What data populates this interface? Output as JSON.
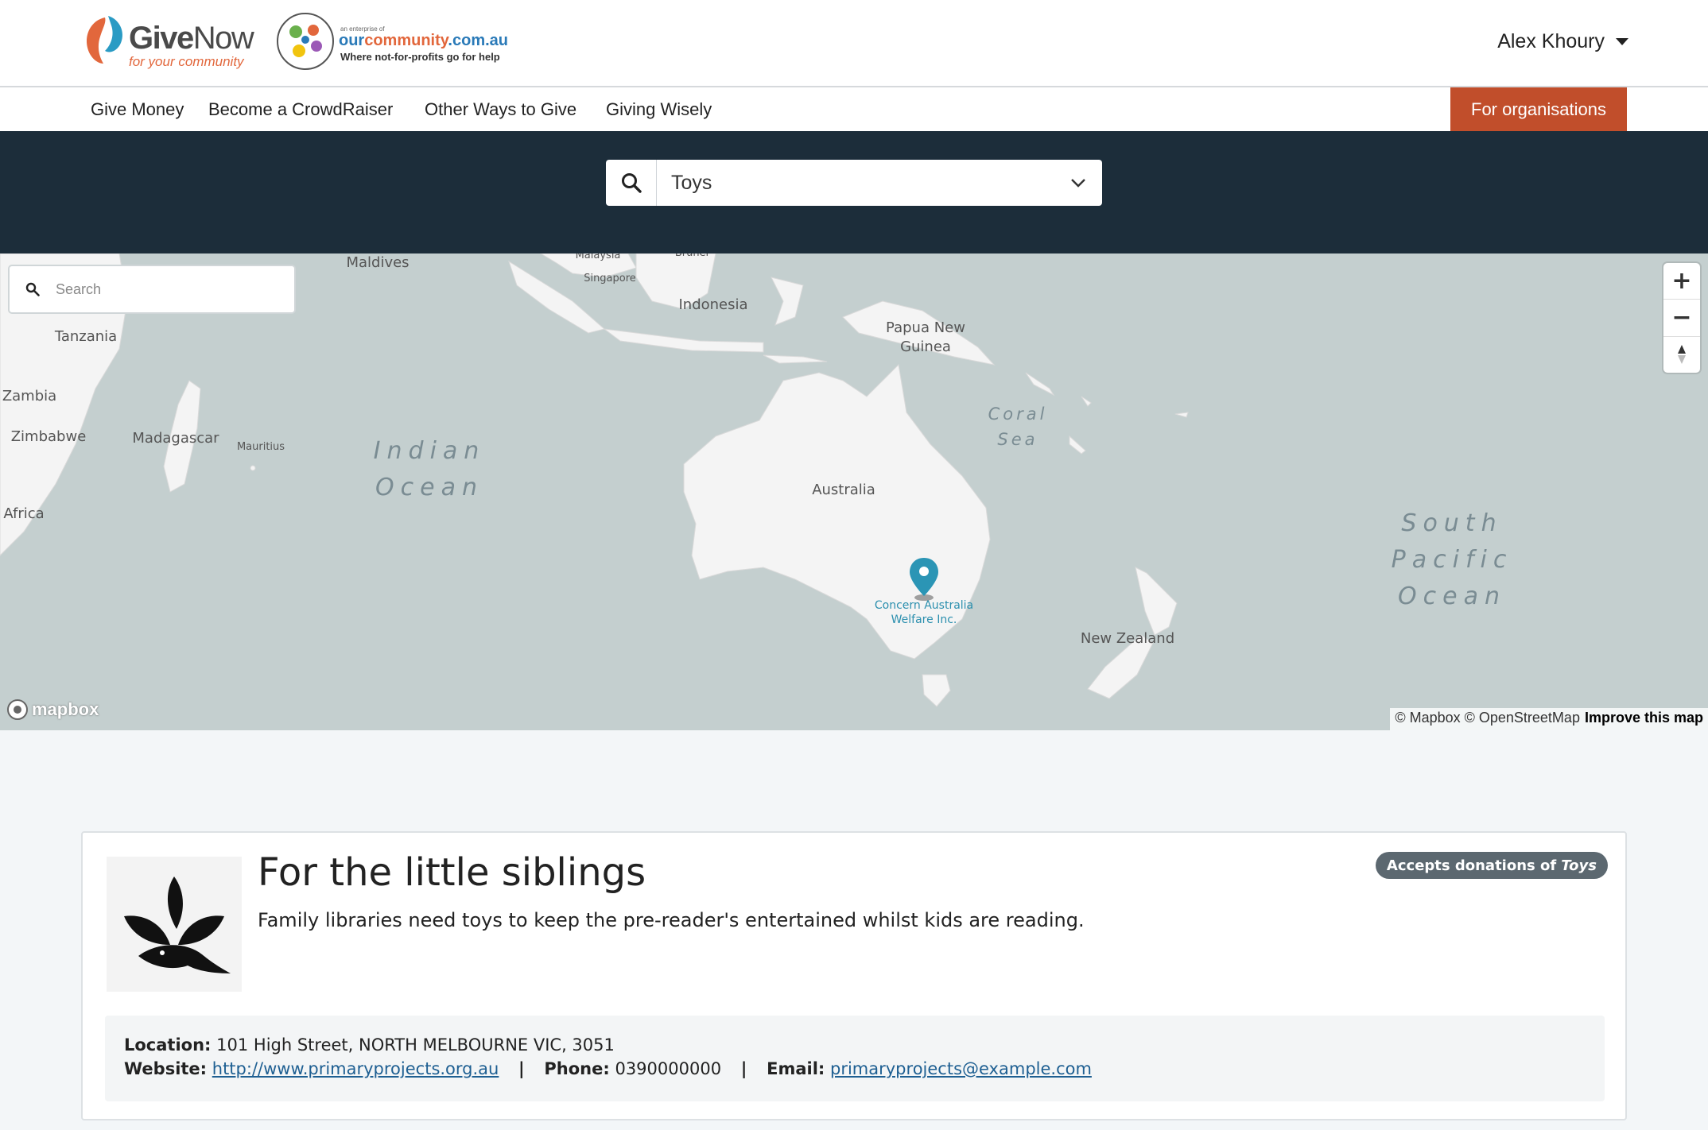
{
  "header": {
    "givenow_logo": {
      "give": "Give",
      "now": "Now",
      "tagline": "for your community"
    },
    "ourcommunity_logo": {
      "enterprise": "an enterprise of",
      "our": "our",
      "community": "community",
      "domain": ".com.au",
      "tagline": "Where not-for-profits go for help"
    },
    "user_name": "Alex Khoury"
  },
  "nav": {
    "items": [
      "Give Money",
      "Become a CrowdRaiser",
      "Other Ways to Give",
      "Giving Wisely"
    ],
    "cta": "For organisations"
  },
  "search": {
    "category_value": "Toys"
  },
  "map": {
    "search_placeholder": "Search",
    "labels": {
      "maldives": "Maldives",
      "malaysia": "Malaysia",
      "brunei": "Brunei",
      "singapore": "Singapore",
      "indonesia": "Indonesia",
      "png_1": "Papua New",
      "png_2": "Guinea",
      "tanzania": "Tanzania",
      "zambia": "Zambia",
      "zimbabwe": "Zimbabwe",
      "madagascar": "Madagascar",
      "mauritius": "Mauritius",
      "africa": "Africa",
      "australia": "Australia",
      "new_zealand": "New Zealand",
      "coral_1": "Coral",
      "coral_2": "Sea",
      "indian_1": "Indian",
      "indian_2": "Ocean",
      "pacific_1": "South",
      "pacific_2": "Pacific",
      "pacific_3": "Ocean"
    },
    "marker_label_1": "Concern Australia",
    "marker_label_2": "Welfare Inc.",
    "marker_color": "#2b95b5",
    "zoom_in": "+",
    "zoom_out": "−",
    "logo_text": "mapbox",
    "attribution": "© Mapbox © OpenStreetMap",
    "improve": "Improve this map"
  },
  "listing": {
    "title": "For the little siblings",
    "description": "Family libraries need toys to keep the pre-reader's entertained whilst kids are reading.",
    "badge_prefix": "Accepts donations of",
    "badge_item": "Toys",
    "location_label": "Location:",
    "location": "101 High Street, NORTH MELBOURNE VIC, 3051",
    "website_label": "Website:",
    "website": "http://www.primaryprojects.org.au",
    "phone_label": "Phone:",
    "phone": "0390000000",
    "email_label": "Email:",
    "email": "primaryprojects@example.com",
    "separator": "|"
  },
  "colors": {
    "accent": "#c14e2b",
    "band": "#1c2d3a",
    "water": "#c4cfcf",
    "land": "#f4f4f4"
  },
  "icons": [
    "search-icon",
    "chevron-down-icon",
    "caret-down-icon",
    "map-pin-icon",
    "compass-icon",
    "bird-leaf-logo-icon"
  ]
}
